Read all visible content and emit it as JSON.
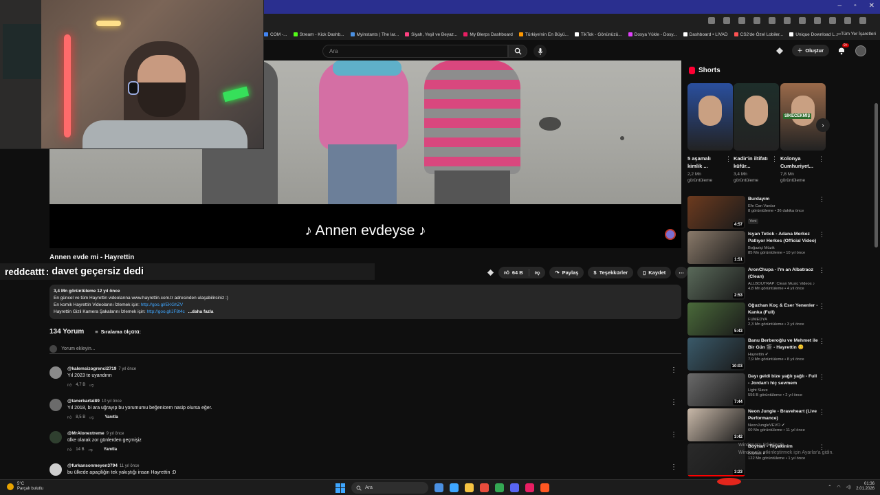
{
  "bookmarks": [
    {
      "label": "COM -...",
      "color": "#4285f4"
    },
    {
      "label": "Stream - Kick Dashb...",
      "color": "#53fc18"
    },
    {
      "label": "Myinstants | The lar...",
      "color": "#4a90e2"
    },
    {
      "label": "Siyah, Yeşil ve Beyaz...",
      "color": "#ff4081"
    },
    {
      "label": "My Blerps Dashboard",
      "color": "#e91e63"
    },
    {
      "label": "Türkiye'nin En Büyü...",
      "color": "#ff9800"
    },
    {
      "label": "TikTok - Gönünüzü...",
      "color": "#ffffff"
    },
    {
      "label": "Dosya Yükle - Dosy...",
      "color": "#e040fb"
    },
    {
      "label": "Dashboard • LIVAD",
      "color": "#ffffff"
    },
    {
      "label": "CS2'de Özel Lobiler...",
      "color": "#ff5252"
    },
    {
      "label": "Unique Download L...",
      "color": "#ffffff"
    }
  ],
  "bookmarks_all": "Tüm Yer İşaretleri",
  "header": {
    "search_placeholder": "Ara",
    "create_label": "Oluştur",
    "notif_count": "9+"
  },
  "video": {
    "subtitle": "♪ Annen evdeyse ♪",
    "title": "Annen evde mi - Hayrettin"
  },
  "chat": {
    "user": "reddcattt",
    "separator": ":",
    "message": "davet geçersiz dedi"
  },
  "actions": {
    "likes": "64 B",
    "share": "Paylaş",
    "thanks": "Teşekkürler",
    "save": "Kaydet"
  },
  "description": {
    "meta": "3,4 Mn görüntüleme  12 yıl önce",
    "line1": "En güncel ve tüm Hayrettin videolarına www.hayrettin.com.tr adresinden ulaşabilirsiniz :)",
    "line2_prefix": "En komik Hayrettin Videolarını İzlemek için: ",
    "line2_link": "http://goo.gl/EKGhZV",
    "line3_prefix": "Hayrettin Gizli Kamera Şakalarını İzlemek için: ",
    "line3_link": "http://goo.gl/JF8t4c",
    "more": "...daha fazla"
  },
  "comments_header": {
    "count": "134 Yorum",
    "sort": "Sıralama ölçütü:",
    "add_placeholder": "Yorum ekleyin..."
  },
  "comments": [
    {
      "author": "@kalemsizogrenci2719",
      "time": "7 yıl önce",
      "text": "Yıl 2023 te uyandırın",
      "likes": "4,7 B",
      "reply": "",
      "color": "#8a8a8a"
    },
    {
      "author": "@tanerkartal89",
      "time": "10 yıl önce",
      "text": "Yıl 2018, bi ara uğrayıp bu yorumumu beğenicem nasip olursa eğer.",
      "likes": "8,5 B",
      "reply": "Yanıtla",
      "color": "#6b6b6b"
    },
    {
      "author": "@MrAlonextreme",
      "time": "9 yıl önce",
      "text": "ülke olarak zor günlerden geçmişiz",
      "likes": "14 B",
      "reply": "Yanıtla",
      "color": "#2f3f2f"
    },
    {
      "author": "@furkansonmeyen3794",
      "time": "11 yıl önce",
      "text": "bu ülkede apaçiliğin tek yakıştığı insan Hayrettin :D",
      "likes": "",
      "reply": "",
      "color": "#cfcfcf"
    }
  ],
  "shorts": {
    "heading": "Shorts",
    "items": [
      {
        "title": "5 aşamalı kimlik ...",
        "views": "2,2 Mn görüntüleme",
        "color": "#2a4f9e"
      },
      {
        "title": "Kadir'in iltifatı küfür...",
        "views": "3,4 Mn görüntüleme",
        "color": "#1e2e2a"
      },
      {
        "title": "Kolonya Cumhuriyet...",
        "views": "7,8 Mn görüntüleme",
        "color": "#9a6a4a"
      }
    ],
    "third_overlay": "SİKECEKMİŞ"
  },
  "recs": [
    {
      "title": "Burdayım",
      "channel": "Efe Can Vardar",
      "views": "8 görüntüleme • 36 dakika önce",
      "badge": "Yeni",
      "duration": "4:57",
      "color": "#6d3b1f"
    },
    {
      "title": "Isyan Tetick - Adana Merkez Patlıyor Herkes (Official Video)",
      "channel": "Boğaziçi Müzik",
      "views": "85 Mn görüntüleme • 10 yıl önce",
      "badge": "",
      "duration": "1:51",
      "color": "#8a7a6a"
    },
    {
      "title": "AronChupa - I'm an Albatraoz (Clean)",
      "channel": "ALLBOUTRAP: Clean Music Videos ♪",
      "views": "4,8 Mn görüntüleme • 4 yıl önce",
      "badge": "",
      "duration": "2:53",
      "color": "#5a6a5a"
    },
    {
      "title": "Oğuzhan Koç & Eser Yenenler - Kanka (Full)",
      "channel": "FUMEDYA",
      "views": "2,3 Mn görüntüleme • 3 yıl önce",
      "badge": "",
      "duration": "5:43",
      "color": "#4a6a3a"
    },
    {
      "title": "Banu Berberoğlu ve Mehmet ile Bir Gün 🎬 - Hayrettin 😊",
      "channel": "Hayrettin ✔",
      "views": "7,9 Mn görüntüleme • 8 yıl önce",
      "badge": "",
      "duration": "10:03",
      "color": "#3a5a6a"
    },
    {
      "title": "Dayı geldi bize yağlı yağlı - Full - Jordan'ı hiç sevmem",
      "channel": "Light Slave",
      "views": "556 B görüntüleme • 2 yıl önce",
      "badge": "",
      "duration": "7:44",
      "color": "#6a6a6a"
    },
    {
      "title": "Neon Jungle - Braveheart (Live Performance)",
      "channel": "NeonJungleVEVO ✔",
      "views": "60 Mn görüntüleme • 11 yıl önce",
      "badge": "",
      "duration": "3:42",
      "color": "#c9b9a9"
    },
    {
      "title": "Boyhan - Tiryakinim",
      "channel": "Boyhan ✔",
      "views": "122 Mn görüntüleme • 1 yıl önce",
      "badge": "",
      "duration": "3:23",
      "color": "#2a2a2a"
    }
  ],
  "watermark": {
    "line1": "Windows'u Etkinleştir",
    "line2": "Windows'u etkinleştirmek için Ayarlar'a gidin."
  },
  "taskbar": {
    "temp": "5°C",
    "weather": "Parçalı bulutlu",
    "search": "Ara",
    "time": "01:36",
    "date": "2.01.2026",
    "apps": [
      "#4a90e2",
      "#3ea6ff",
      "#f5c342",
      "#e74c3c",
      "#34a853",
      "#5865f2",
      "#e91e63",
      "#ff5722"
    ]
  }
}
